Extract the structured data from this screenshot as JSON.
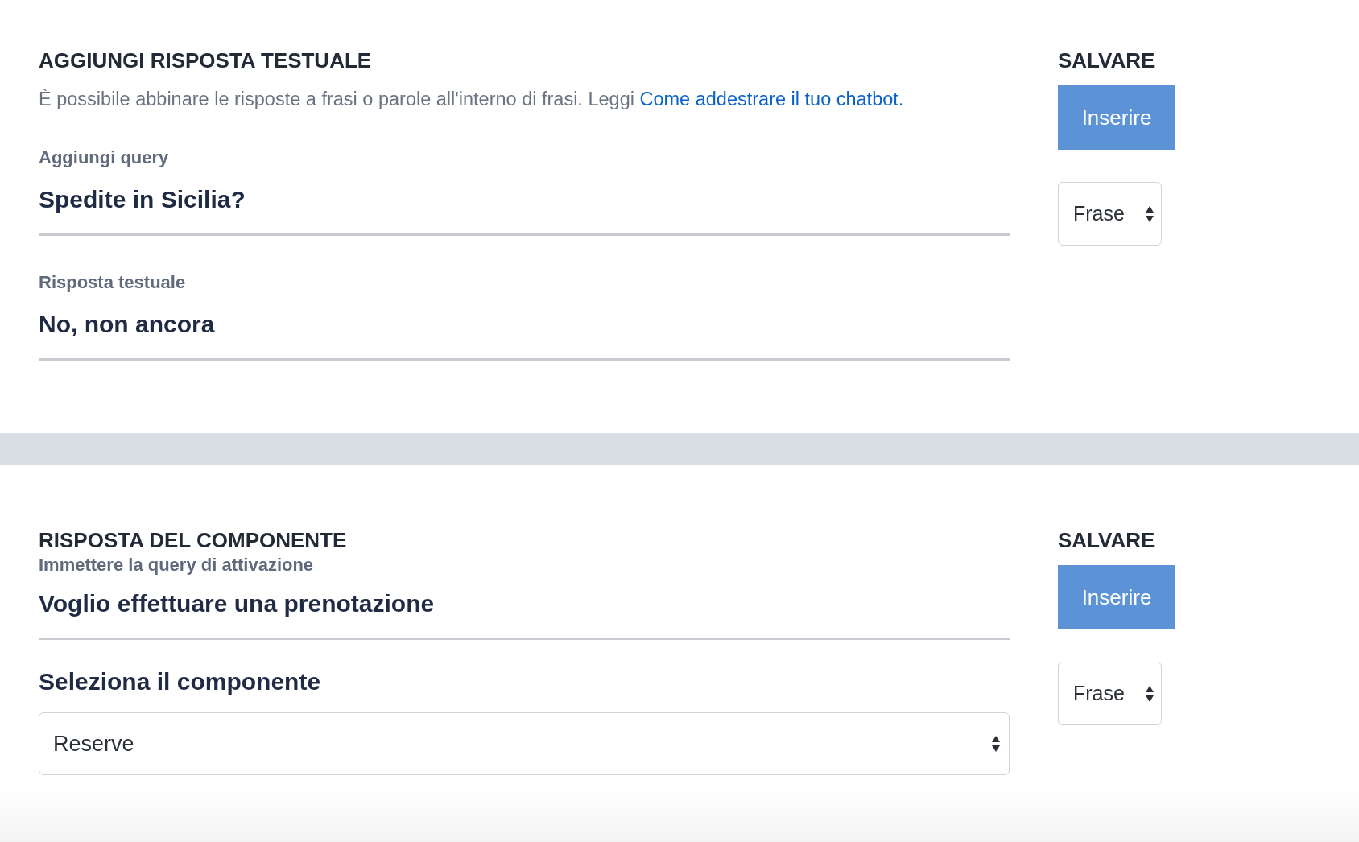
{
  "sections": [
    {
      "title": "AGGIUNGI RISPOSTA TESTUALE",
      "description": {
        "text": "È possibile abbinare le risposte a frasi o parole all'interno di frasi. Leggi",
        "link": "Come addestrare il tuo chatbot."
      },
      "fields": [
        {
          "label": "Aggiungi query",
          "value": "Spedite in Sicilia?"
        },
        {
          "label": "Risposta testuale",
          "value": "No, non ancora"
        }
      ],
      "side": {
        "heading": "SALVARE",
        "button": "Inserire",
        "select": "Frase"
      }
    },
    {
      "title": "RISPOSTA DEL COMPONENTE",
      "subtitle": "Immettere la query di attivazione",
      "fields": [
        {
          "value": "Voglio effettuare una prenotazione"
        }
      ],
      "component": {
        "label": "Seleziona il componente",
        "value": "Reserve"
      },
      "side": {
        "heading": "SALVARE",
        "button": "Inserire",
        "select": "Frase"
      }
    }
  ]
}
